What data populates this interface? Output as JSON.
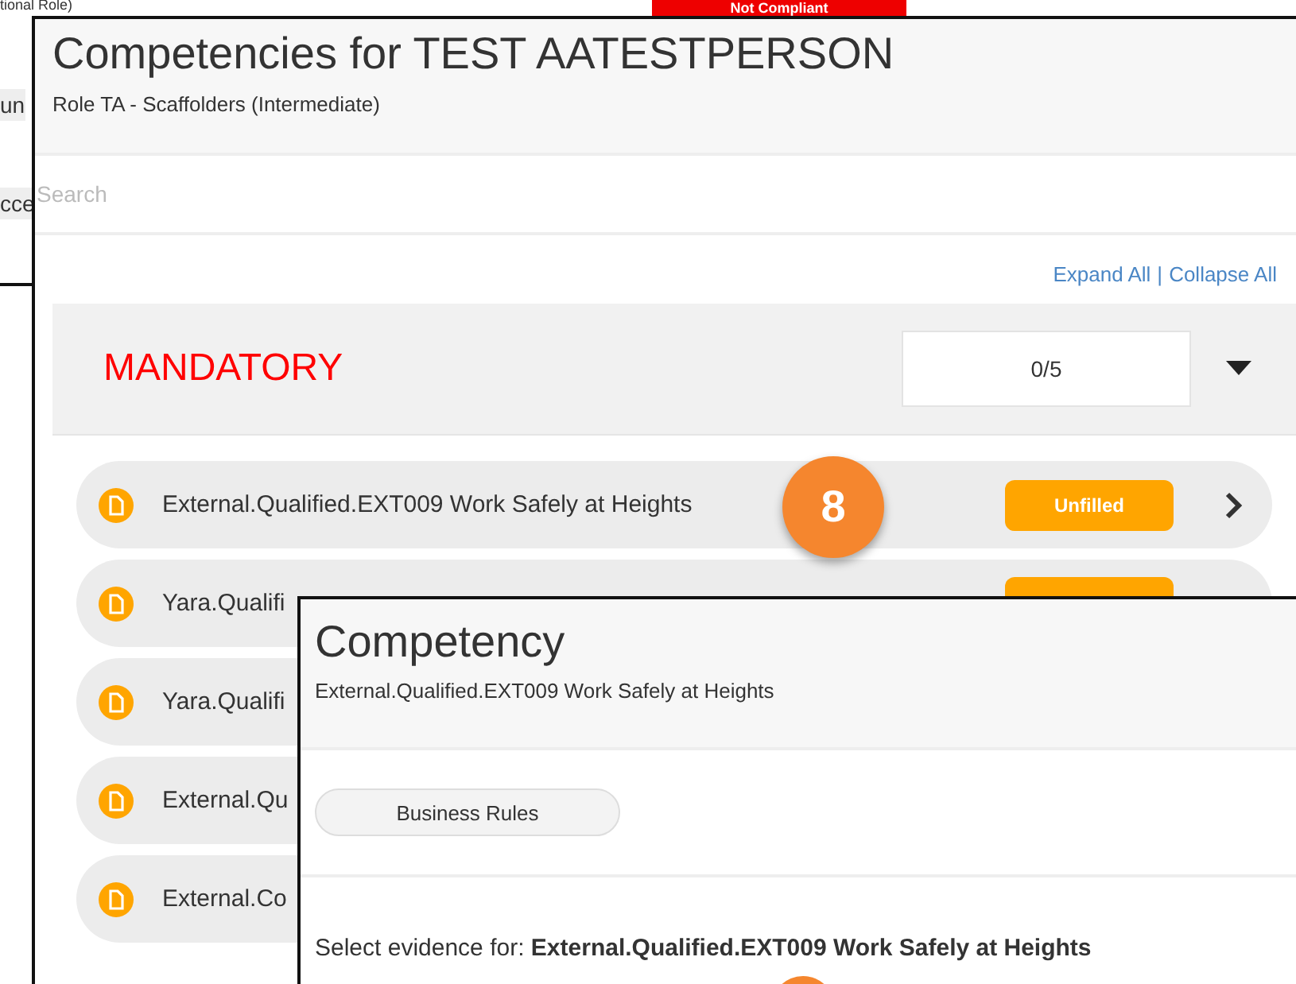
{
  "background_page": {
    "items": [
      "tional Role)",
      "un",
      "cce"
    ],
    "status_badge": "Not Compliant"
  },
  "competencies_dialog": {
    "title": "Competencies for TEST AATESTPERSON",
    "subtitle": "Role TA - Scaffolders (Intermediate)",
    "search": {
      "placeholder": "Search"
    },
    "expand_all": "Expand All",
    "separator": "|",
    "collapse_all": "Collapse All",
    "section": {
      "title": "MANDATORY",
      "count": "0/5",
      "expanded": true
    },
    "rows": [
      {
        "label": "External.Qualified.EXT009 Work Safely at Heights",
        "status": "Unfilled"
      },
      {
        "label": "Yara.Qualifi",
        "covered_status": true
      },
      {
        "label": "Yara.Qualifi"
      },
      {
        "label": "External.Qu"
      },
      {
        "label": "External.Co"
      }
    ]
  },
  "callout": "8",
  "competency_dialog": {
    "title": "Competency",
    "subtitle": "External.Qualified.EXT009 Work Safely at Heights",
    "button": "Business Rules",
    "evidence_prompt": "Select evidence for: **External.Qualified.EXT009 Work Safely at Heights**"
  }
}
